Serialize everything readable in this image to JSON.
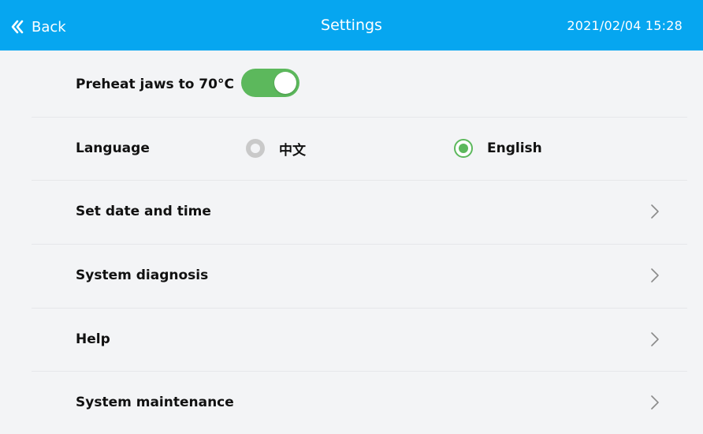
{
  "header": {
    "back_label": "Back",
    "title": "Settings",
    "datetime": "2021/02/04  15:28",
    "bg_color": "#06a6f0"
  },
  "settings": {
    "preheat": {
      "label": "Preheat jaws to 70°C",
      "enabled": true,
      "accent_color": "#5cb85c"
    },
    "language": {
      "label": "Language",
      "options": [
        {
          "label": "中文",
          "selected": false
        },
        {
          "label": "English",
          "selected": true
        }
      ]
    },
    "items": [
      {
        "label": "Set date and time",
        "icon": "chevron-right-icon"
      },
      {
        "label": "System diagnosis",
        "icon": "chevron-right-icon"
      },
      {
        "label": "Help",
        "icon": "chevron-right-icon"
      },
      {
        "label": "System maintenance",
        "icon": "chevron-right-icon"
      }
    ]
  }
}
